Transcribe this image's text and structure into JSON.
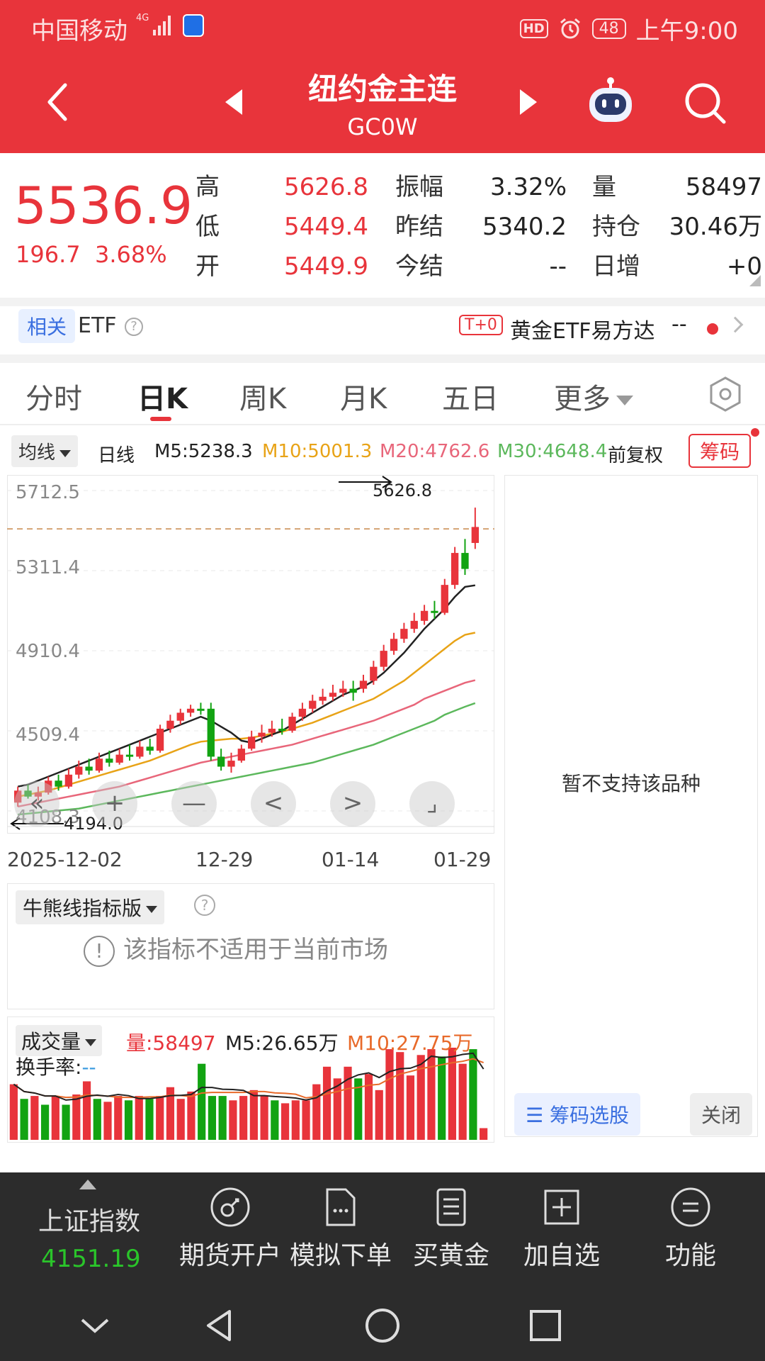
{
  "status": {
    "carrier": "中国移动",
    "net": "4G",
    "hd": "HD",
    "battery": "48",
    "time": "上午9:00"
  },
  "header": {
    "title": "纽约金主连",
    "code": "GC0W"
  },
  "quote": {
    "price": "5536.9",
    "change": "196.7",
    "change_pct": "3.68%",
    "stats": [
      {
        "label": "高",
        "value": "5626.8",
        "color": "red"
      },
      {
        "label": "低",
        "value": "5449.4",
        "color": "red"
      },
      {
        "label": "开",
        "value": "5449.9",
        "color": "red"
      },
      {
        "label": "振幅",
        "value": "3.32%",
        "color": "dark"
      },
      {
        "label": "昨结",
        "value": "5340.2",
        "color": "dark"
      },
      {
        "label": "今结",
        "value": "--",
        "color": "dark"
      },
      {
        "label": "量",
        "value": "58497",
        "color": "dark"
      },
      {
        "label": "持仓",
        "value": "30.46万",
        "color": "dark"
      },
      {
        "label": "日增",
        "value": "+0",
        "color": "dark"
      }
    ]
  },
  "related": {
    "tag": "相关",
    "etf": "ETF",
    "t0": "T+0",
    "name": "黄金ETF易方达",
    "value": "--"
  },
  "tabs": [
    {
      "label": "分时",
      "active": false
    },
    {
      "label": "日K",
      "active": true
    },
    {
      "label": "周K",
      "active": false
    },
    {
      "label": "月K",
      "active": false
    },
    {
      "label": "五日",
      "active": false
    },
    {
      "label": "更多",
      "active": false
    }
  ],
  "ma_row": {
    "selector": "均线",
    "period": "日线",
    "m5": "M5:5238.3",
    "m10": "M10:5001.3",
    "m20": "M20:4762.6",
    "m30": "M30:4648.4",
    "adjust": "前复权",
    "chip": "筹码",
    "colors": {
      "m5": "#222222",
      "m10": "#e8a317",
      "m20": "#e8667a",
      "m30": "#5cb85c"
    }
  },
  "kline": {
    "y_labels": [
      "5712.5",
      "5311.4",
      "4910.4",
      "4509.4",
      "4108.3"
    ],
    "high_label": "5626.8",
    "low_label": "4194.0",
    "x_labels": [
      "2025-12-02",
      "12-29",
      "01-14",
      "01-29"
    ],
    "controls": [
      "«",
      "+",
      "—",
      "<",
      ">",
      "⌟"
    ]
  },
  "chart_data": {
    "type": "candlestick",
    "y_range": [
      4108.3,
      5712.5
    ],
    "candles": [
      [
        4150,
        4210,
        4130,
        4230,
        0
      ],
      [
        4210,
        4180,
        4170,
        4240,
        0
      ],
      [
        4180,
        4200,
        4160,
        4230,
        0
      ],
      [
        4200,
        4260,
        4190,
        4280,
        0
      ],
      [
        4260,
        4230,
        4210,
        4290,
        0
      ],
      [
        4230,
        4290,
        4220,
        4320,
        0
      ],
      [
        4290,
        4330,
        4270,
        4360,
        0
      ],
      [
        4330,
        4310,
        4290,
        4370,
        0
      ],
      [
        4310,
        4370,
        4300,
        4400,
        0
      ],
      [
        4370,
        4350,
        4330,
        4410,
        0
      ],
      [
        4350,
        4390,
        4340,
        4420,
        0
      ],
      [
        4390,
        4380,
        4360,
        4440,
        0
      ],
      [
        4380,
        4430,
        4370,
        4460,
        0
      ],
      [
        4430,
        4410,
        4390,
        4470,
        0
      ],
      [
        4410,
        4520,
        4400,
        4540,
        0
      ],
      [
        4520,
        4560,
        4500,
        4590,
        0
      ],
      [
        4560,
        4600,
        4540,
        4620,
        0
      ],
      [
        4600,
        4620,
        4580,
        4640,
        0
      ],
      [
        4620,
        4610,
        4590,
        4650,
        0
      ],
      [
        4620,
        4380,
        4360,
        4650,
        0
      ],
      [
        4380,
        4330,
        4310,
        4420,
        0
      ],
      [
        4330,
        4360,
        4300,
        4400,
        0
      ],
      [
        4360,
        4420,
        4350,
        4440,
        0
      ],
      [
        4420,
        4480,
        4410,
        4510,
        0
      ],
      [
        4480,
        4500,
        4450,
        4540,
        0
      ],
      [
        4500,
        4520,
        4480,
        4560,
        0
      ],
      [
        4520,
        4510,
        4490,
        4570,
        0
      ],
      [
        4510,
        4580,
        4500,
        4600,
        0
      ],
      [
        4580,
        4620,
        4560,
        4650,
        0
      ],
      [
        4620,
        4660,
        4600,
        4690,
        0
      ],
      [
        4660,
        4680,
        4640,
        4720,
        0
      ],
      [
        4680,
        4700,
        4660,
        4740,
        0
      ],
      [
        4700,
        4720,
        4680,
        4760,
        0
      ],
      [
        4720,
        4700,
        4660,
        4760,
        0
      ],
      [
        4720,
        4760,
        4700,
        4790,
        0
      ],
      [
        4760,
        4830,
        4740,
        4860,
        0
      ],
      [
        4830,
        4910,
        4810,
        4940,
        0
      ],
      [
        4910,
        4970,
        4890,
        5000,
        0
      ],
      [
        4970,
        5020,
        4950,
        5050,
        0
      ],
      [
        5020,
        5060,
        5000,
        5100,
        0
      ],
      [
        5060,
        5110,
        5040,
        5140,
        0
      ],
      [
        5110,
        5100,
        5070,
        5160,
        0
      ],
      [
        5100,
        5240,
        5090,
        5270,
        0
      ],
      [
        5240,
        5400,
        5220,
        5430,
        0
      ],
      [
        5400,
        5320,
        5290,
        5470,
        0
      ],
      [
        5450,
        5530,
        5420,
        5627,
        0
      ]
    ],
    "ma": {
      "m5": [
        4230,
        4240,
        4260,
        4280,
        4300,
        4320,
        4340,
        4360,
        4380,
        4400,
        4420,
        4440,
        4460,
        4480,
        4500,
        4520,
        4540,
        4560,
        4580,
        4560,
        4530,
        4500,
        4460,
        4450,
        4470,
        4490,
        4510,
        4540,
        4570,
        4600,
        4630,
        4660,
        4690,
        4710,
        4730,
        4760,
        4800,
        4850,
        4900,
        4960,
        5020,
        5070,
        5120,
        5180,
        5230,
        5238
      ],
      "m10": [
        4180,
        4190,
        4200,
        4210,
        4225,
        4240,
        4255,
        4270,
        4285,
        4300,
        4315,
        4330,
        4345,
        4360,
        4380,
        4400,
        4420,
        4440,
        4455,
        4460,
        4465,
        4470,
        4470,
        4475,
        4485,
        4495,
        4505,
        4520,
        4535,
        4550,
        4570,
        4590,
        4610,
        4630,
        4650,
        4670,
        4700,
        4730,
        4760,
        4800,
        4840,
        4880,
        4920,
        4960,
        4990,
        5001
      ],
      "m20": [
        4130,
        4140,
        4150,
        4160,
        4170,
        4180,
        4190,
        4200,
        4210,
        4220,
        4230,
        4245,
        4260,
        4275,
        4290,
        4305,
        4320,
        4335,
        4350,
        4360,
        4370,
        4380,
        4390,
        4400,
        4410,
        4420,
        4430,
        4440,
        4455,
        4470,
        4485,
        4500,
        4515,
        4530,
        4545,
        4560,
        4580,
        4600,
        4620,
        4640,
        4670,
        4690,
        4710,
        4730,
        4750,
        4763
      ],
      "m30": [
        4090,
        4095,
        4100,
        4105,
        4110,
        4115,
        4120,
        4130,
        4140,
        4150,
        4160,
        4170,
        4180,
        4190,
        4200,
        4210,
        4220,
        4230,
        4240,
        4250,
        4260,
        4270,
        4280,
        4290,
        4300,
        4310,
        4320,
        4330,
        4340,
        4350,
        4365,
        4380,
        4395,
        4410,
        4425,
        4440,
        4460,
        4480,
        4500,
        4520,
        4540,
        4560,
        4590,
        4610,
        4630,
        4648
      ]
    },
    "volume_m5": "M5:26.65万",
    "volume_m10": "M10:27.75万",
    "volume_label": "量:58497",
    "volumes": [
      0.38,
      0.28,
      0.3,
      0.24,
      0.3,
      0.24,
      0.31,
      0.4,
      0.28,
      0.26,
      0.3,
      0.27,
      0.3,
      0.28,
      0.3,
      0.36,
      0.28,
      0.33,
      0.52,
      0.3,
      0.3,
      0.27,
      0.3,
      0.34,
      0.3,
      0.27,
      0.25,
      0.27,
      0.27,
      0.38,
      0.5,
      0.42,
      0.5,
      0.42,
      0.45,
      0.34,
      0.62,
      0.6,
      0.44,
      0.58,
      0.62,
      0.57,
      0.63,
      0.52,
      0.62,
      0.08
    ],
    "vol_up": [
      true,
      false,
      true,
      false,
      true,
      false,
      true,
      true,
      false,
      true,
      true,
      false,
      true,
      false,
      true,
      true,
      true,
      true,
      false,
      false,
      false,
      true,
      true,
      true,
      true,
      false,
      true,
      true,
      true,
      true,
      true,
      true,
      true,
      false,
      true,
      true,
      true,
      true,
      true,
      true,
      true,
      false,
      true,
      true,
      false,
      true
    ]
  },
  "indicator": {
    "selector": "牛熊线指标版",
    "message": "该指标不适用于当前市场"
  },
  "volume_panel": {
    "selector": "成交量",
    "turnover_label": "换手率:",
    "turnover_value": "--"
  },
  "right_panel": {
    "message": "暂不支持该品种",
    "chip_select": "筹码选股",
    "close": "关闭"
  },
  "bottom": {
    "index_name": "上证指数",
    "index_value": "4151.19",
    "buttons": [
      "期货开户",
      "模拟下单",
      "买黄金",
      "加自选",
      "功能"
    ]
  },
  "colors": {
    "brand": "#e8343b",
    "up": "#e8343b",
    "down": "#12a312"
  }
}
